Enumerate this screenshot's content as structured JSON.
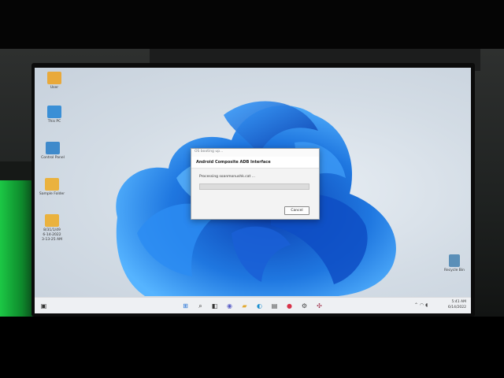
{
  "desktop_icons": [
    {
      "name": "user-folder-icon",
      "label": "User",
      "color": "#e9a93a"
    },
    {
      "name": "this-pc-icon",
      "label": "This PC",
      "color": "#3a8fd6"
    },
    {
      "name": "control-panel-icon",
      "label": "Control Panel",
      "color": "#3f8acb"
    },
    {
      "name": "folder-icon",
      "label": "Sample Folder",
      "color": "#eab23e"
    },
    {
      "name": "folder-icon",
      "label": "8/31/1/49\n6-14-2022\n3-13-25 AM",
      "color": "#eab23e"
    },
    {
      "name": "recycle-bin-icon",
      "label": "Recycle Bin",
      "color": "#5a8fb8"
    }
  ],
  "dialog": {
    "title": "OS booting up...",
    "header": "Android Composite ADB Interface",
    "status": "Processing soanmonushk.cat ...",
    "progress": 0,
    "cancel_label": "Cancel"
  },
  "taskbar": {
    "items": [
      {
        "name": "widgets-icon",
        "glyph": "▣"
      },
      {
        "name": "start-button-icon",
        "glyph": "⊞"
      },
      {
        "name": "search-icon",
        "glyph": "⌕"
      },
      {
        "name": "task-view-icon",
        "glyph": "◧"
      },
      {
        "name": "chat-icon",
        "glyph": "◉"
      },
      {
        "name": "file-explorer-icon",
        "glyph": "▰"
      },
      {
        "name": "edge-browser-icon",
        "glyph": "◐"
      },
      {
        "name": "store-icon",
        "glyph": "▤"
      },
      {
        "name": "app-icon-red",
        "glyph": "●"
      },
      {
        "name": "settings-gear-icon",
        "glyph": "⚙"
      },
      {
        "name": "app-icon-tool",
        "glyph": "✣"
      }
    ],
    "tray_icons": "⌃  ◠  ◖",
    "time": "5:41 AM",
    "date": "6/14/2022"
  }
}
